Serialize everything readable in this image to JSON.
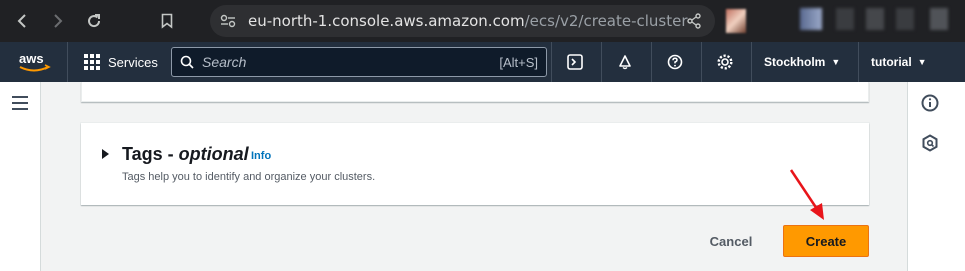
{
  "browser": {
    "url_host": "eu-north-1.console.aws.amazon.com",
    "url_path": "/ecs/v2/create-cluster?region..."
  },
  "aws_nav": {
    "logo_text": "aws",
    "services_label": "Services",
    "search_placeholder": "Search",
    "search_shortcut": "[Alt+S]",
    "region": "Stockholm",
    "account": "tutorial"
  },
  "tags_section": {
    "title_main": "Tags - ",
    "title_optional": "optional",
    "info_label": "Info",
    "description": "Tags help you to identify and organize your clusters."
  },
  "actions": {
    "cancel_label": "Cancel",
    "create_label": "Create"
  },
  "colors": {
    "aws_nav_bg": "#232f3e",
    "primary_button": "#ff9900",
    "info_link": "#0073bb",
    "annotation_arrow": "#e8141a"
  }
}
